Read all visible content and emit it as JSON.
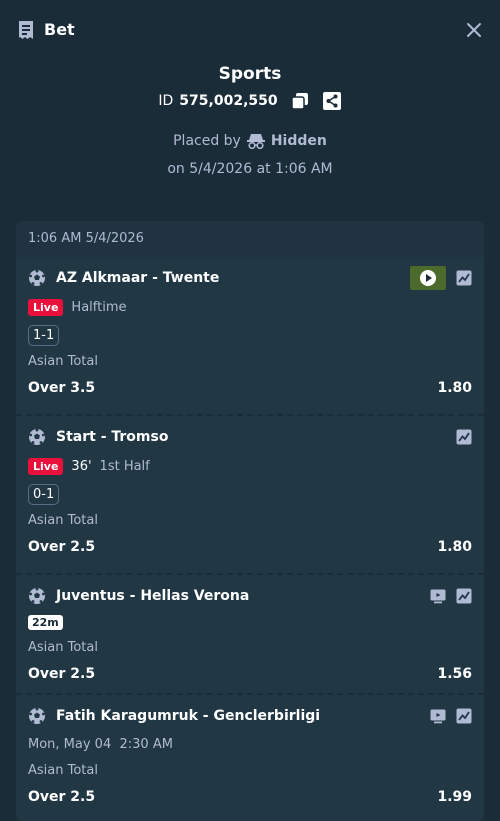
{
  "header": {
    "title": "Bet"
  },
  "summary": {
    "type": "Sports",
    "id_label": "ID",
    "id_value": "575,002,550",
    "placed_by_label": "Placed by",
    "placed_by_user": "Hidden",
    "placed_on": "on 5/4/2026 at 1:06 AM"
  },
  "panel": {
    "time": "1:06 AM 5/4/2026",
    "legs": [
      {
        "match": "AZ Alkmaar - Twente",
        "live": "Live",
        "status": "Halftime",
        "score": "1-1",
        "market": "Asian Total",
        "selection": "Over 3.5",
        "odds": "1.80"
      },
      {
        "match": "Start - Tromso",
        "live": "Live",
        "minute": "36'",
        "status": "1st Half",
        "score": "0-1",
        "market": "Asian Total",
        "selection": "Over 2.5",
        "odds": "1.80"
      },
      {
        "match": "Juventus - Hellas Verona",
        "countdown": "22m",
        "market": "Asian Total",
        "selection": "Over 2.5",
        "odds": "1.56"
      },
      {
        "match": "Fatih Karagumruk - Genclerbirligi",
        "kickoff": "Mon, May 04  2:30 AM",
        "market": "Asian Total",
        "selection": "Over 2.5",
        "odds": "1.99"
      }
    ]
  },
  "colors": {
    "background": "#1a2c38",
    "panel": "#213743",
    "live": "#e9113c",
    "muted_text": "#b1bad3"
  }
}
